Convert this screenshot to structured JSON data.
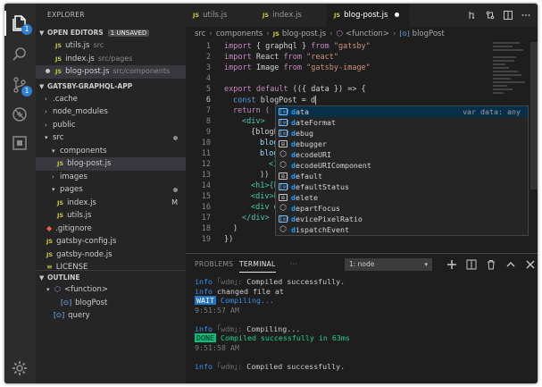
{
  "explorer": {
    "title": "EXPLORER",
    "open_editors": {
      "label": "OPEN EDITORS",
      "badge": "1 UNSAVED",
      "items": [
        {
          "name": "utils.js",
          "path": "src"
        },
        {
          "name": "index.js",
          "path": "src/pages"
        },
        {
          "name": "blog-post.js",
          "path": "src/components"
        }
      ]
    },
    "project": {
      "label": "GATSBY-GRAPHQL-APP",
      "tree": [
        {
          "name": ".cache",
          "type": "folder"
        },
        {
          "name": "node_modules",
          "type": "folder"
        },
        {
          "name": "public",
          "type": "folder"
        },
        {
          "name": "src",
          "type": "folder"
        },
        {
          "name": "components",
          "type": "folder"
        },
        {
          "name": "blog-post.js",
          "type": "file"
        },
        {
          "name": "images",
          "type": "folder"
        },
        {
          "name": "pages",
          "type": "folder"
        },
        {
          "name": "index.js",
          "type": "file",
          "flag": "M"
        },
        {
          "name": "utils.js",
          "type": "file"
        },
        {
          "name": ".gitignore",
          "type": "file"
        },
        {
          "name": "gatsby-config.js",
          "type": "file"
        },
        {
          "name": "gatsby-node.js",
          "type": "file"
        },
        {
          "name": "LICENSE",
          "type": "file"
        }
      ]
    },
    "outline": {
      "label": "OUTLINE",
      "items": [
        {
          "name": "<function>"
        },
        {
          "name": "blogPost"
        },
        {
          "name": "query"
        }
      ]
    }
  },
  "activity_badges": {
    "explorer": "1",
    "scm": "1"
  },
  "editor": {
    "tabs": [
      {
        "label": "utils.js"
      },
      {
        "label": "index.js"
      },
      {
        "label": "blog-post.js"
      }
    ],
    "breadcrumb": [
      "src",
      "components",
      "blog-post.js",
      "<function>",
      "blogPost"
    ],
    "breadcrumb_icons": {
      "js": "JS",
      "function": "⬡",
      "var": "[⊙]"
    },
    "line_numbers": [
      "1",
      "2",
      "3",
      "4",
      "5",
      "6",
      "7",
      "8",
      "9",
      "10",
      "11",
      "12",
      "13",
      "14",
      "15",
      "16",
      "17",
      "18",
      "19"
    ],
    "code_lines": {
      "l1": {
        "kw": "import",
        "mid": " { graphql } ",
        "kw2": "from",
        "str": " \"gatsby\""
      },
      "l2": {
        "kw": "import",
        "mid": " React ",
        "kw2": "from",
        "str": " \"react\""
      },
      "l3": {
        "kw": "import",
        "mid": " Image ",
        "kw2": "from",
        "str": " \"gatsby-image\""
      },
      "l5": {
        "kw": "export",
        "kw2": " default",
        "rest": " (({ data }) => {"
      },
      "l6": {
        "kb": "const",
        "rest": " blogPost = d"
      },
      "l7": "return (",
      "l8": "<div>",
      "l9": "{blogP",
      "l10": "blog",
      "l11": "blog",
      "l12": "<I",
      "l13": "))",
      "l14": "<h1>{b",
      "l15": "<div>P",
      "l16": "<div d",
      "l17": "</div>",
      "l18": ")",
      "l19": "})"
    },
    "suggestions": [
      {
        "hl": "d",
        "rest": "ata",
        "icon": "[⊙]",
        "kind": "var",
        "detail": "var data: any"
      },
      {
        "hl": "d",
        "rest": "ateFormat",
        "icon": "[⊙]",
        "kind": "var"
      },
      {
        "hl": "d",
        "rest": "ebug",
        "icon": "[⊙]",
        "kind": "var"
      },
      {
        "hl": "d",
        "rest": "ebugger",
        "icon": "⊞",
        "kind": "keyword"
      },
      {
        "hl": "d",
        "rest": "ecodeURI",
        "icon": "⬡",
        "kind": "function"
      },
      {
        "hl": "d",
        "rest": "ecodeURIComponent",
        "icon": "⬡",
        "kind": "function"
      },
      {
        "hl": "d",
        "rest": "efault",
        "icon": "⊞",
        "kind": "keyword"
      },
      {
        "hl": "d",
        "rest": "efaultStatus",
        "icon": "[⊙]",
        "kind": "var"
      },
      {
        "hl": "d",
        "rest": "elete",
        "icon": "⊞",
        "kind": "keyword"
      },
      {
        "hl": "d",
        "rest": "epartFocus",
        "icon": "⬡",
        "kind": "function"
      },
      {
        "hl": "d",
        "rest": "evicePixelRatio",
        "icon": "[⊙]",
        "kind": "var"
      },
      {
        "hl": "d",
        "rest": "ispatchEvent",
        "icon": "⬡",
        "kind": "function"
      }
    ]
  },
  "panel": {
    "tabs": [
      "PROBLEMS",
      "TERMINAL",
      "···"
    ],
    "terminal_select": "1: node",
    "lines": [
      {
        "info": "info",
        "pipe": " ｢wdm｣:",
        "text": " Compiled successfully."
      },
      {
        "info": "info",
        "pipe": "",
        "text": " changed file at"
      },
      {
        "badge": "WAIT",
        "text": " Compiling..."
      },
      {
        "time": "9:51:57 AM"
      },
      {
        "blank": ""
      },
      {
        "info": "info",
        "pipe": " ｢wdm｣:",
        "text": " Compiling..."
      },
      {
        "badge": "DONE",
        "text": " Compiled successfully in 63ms"
      },
      {
        "time": "9:51:58 AM"
      },
      {
        "blank": ""
      },
      {
        "info": "info",
        "pipe": " ｢wdm｣:",
        "text": " Compiled successfully."
      }
    ]
  }
}
